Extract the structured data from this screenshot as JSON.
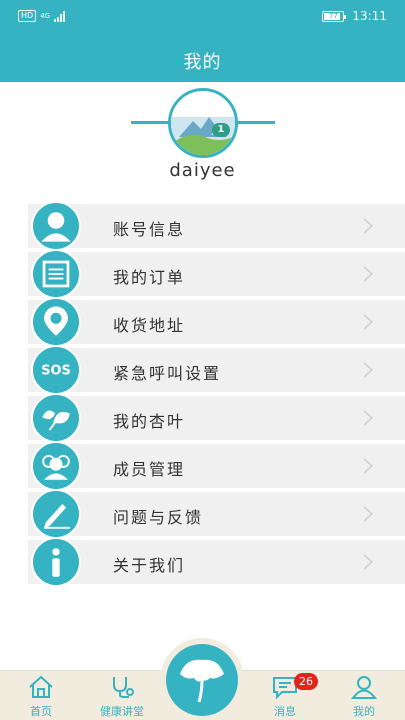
{
  "status_bar": {
    "hd": "HD",
    "network": "4G",
    "battery": "77",
    "time": "13:11"
  },
  "header": {
    "title": "我的"
  },
  "profile": {
    "username": "daiyee",
    "level": "1"
  },
  "menu": {
    "items": [
      {
        "label": "账号信息",
        "icon": "user-icon"
      },
      {
        "label": "我的订单",
        "icon": "document-icon"
      },
      {
        "label": "收货地址",
        "icon": "location-pin-icon"
      },
      {
        "label": "紧急呼叫设置",
        "icon": "sos-icon",
        "icon_text": "SOS"
      },
      {
        "label": "我的杏叶",
        "icon": "ginkgo-leaves-icon"
      },
      {
        "label": "成员管理",
        "icon": "group-icon"
      },
      {
        "label": "问题与反馈",
        "icon": "pen-icon"
      },
      {
        "label": "关于我们",
        "icon": "info-icon"
      }
    ]
  },
  "bottom_nav": {
    "items": [
      {
        "label": "首页",
        "icon": "home-icon"
      },
      {
        "label": "健康讲堂",
        "icon": "stethoscope-icon"
      },
      {
        "label": "",
        "icon": "ginkgo-leaf-icon"
      },
      {
        "label": "消息",
        "icon": "message-icon"
      },
      {
        "label": "我的",
        "icon": "person-icon"
      }
    ],
    "message_badge": "26"
  },
  "colors": {
    "primary": "#36b3c2",
    "nav_bg": "#f2ecde",
    "badge": "#e0251b",
    "item_bg": "#f0f0f0"
  }
}
